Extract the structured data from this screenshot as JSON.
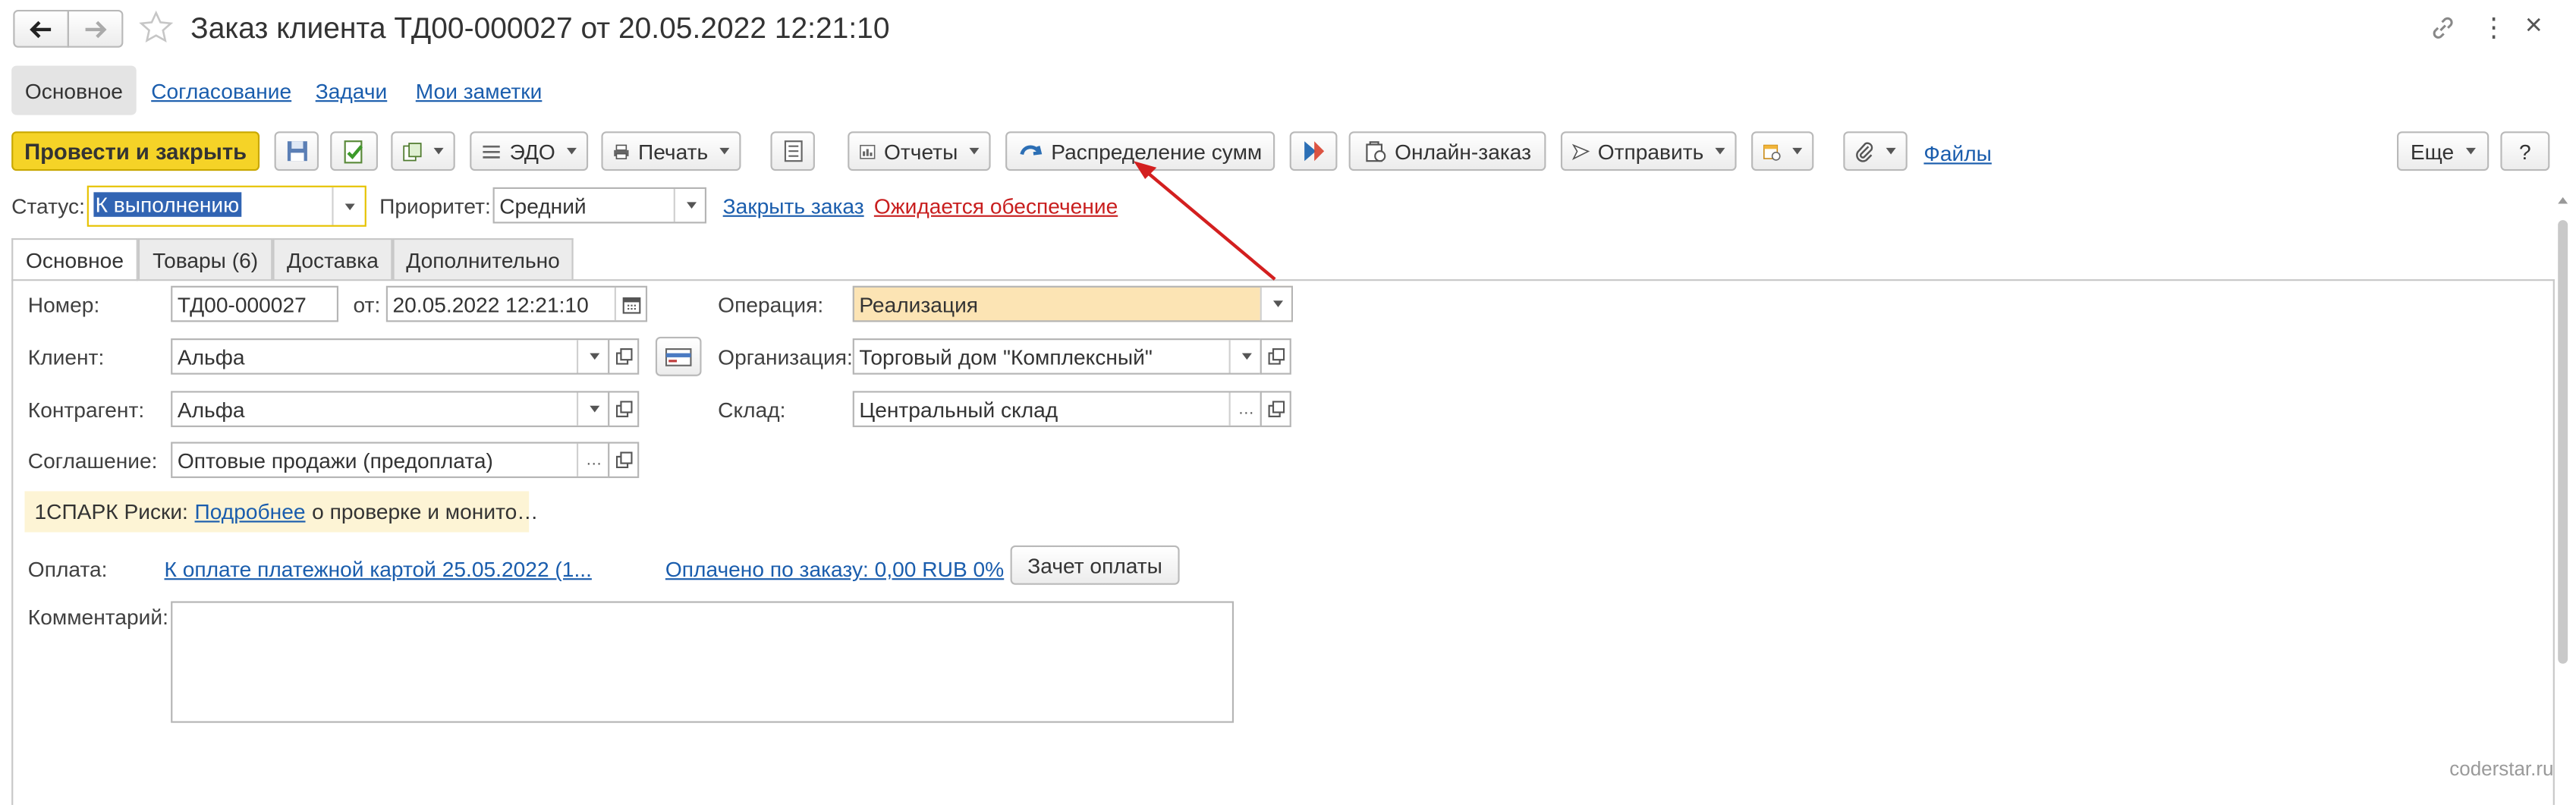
{
  "window": {
    "title": "Заказ клиента ТД00-000027 от 20.05.2022 12:21:10",
    "close_glyph": "×",
    "more_glyph": "⋮"
  },
  "nav": {
    "items": [
      "Основное",
      "Согласование",
      "Задачи",
      "Мои заметки"
    ]
  },
  "toolbar": {
    "post_close": "Провести и закрыть",
    "edo": "ЭДО",
    "print": "Печать",
    "reports": "Отчеты",
    "distribution": "Распределение сумм",
    "online_order": "Онлайн-заказ",
    "send": "Отправить",
    "files": "Файлы",
    "more": "Еще",
    "help": "?"
  },
  "status_row": {
    "status_label": "Статус:",
    "status_value": "К выполнению",
    "priority_label": "Приоритет:",
    "priority_value": "Средний",
    "close_order": "Закрыть заказ",
    "awaiting": "Ожидается обеспечение"
  },
  "tabs": [
    "Основное",
    "Товары (6)",
    "Доставка",
    "Дополнительно"
  ],
  "form": {
    "number_label": "Номер:",
    "number_value": "ТД00-000027",
    "from_label": "от:",
    "date_value": "20.05.2022 12:21:10",
    "client_label": "Клиент:",
    "client_value": "Альфа",
    "counterparty_label": "Контрагент:",
    "counterparty_value": "Альфа",
    "agreement_label": "Соглашение:",
    "agreement_value": "Оптовые продажи (предоплата)",
    "operation_label": "Операция:",
    "operation_value": "Реализация",
    "organization_label": "Организация:",
    "organization_value": "Торговый дом \"Комплексный\"",
    "warehouse_label": "Склад:",
    "warehouse_value": "Центральный склад",
    "spark_prefix": "1СПАРК Риски:",
    "spark_link": "Подробнее",
    "spark_suffix": "о проверке и монито…",
    "payment_label": "Оплата:",
    "payment_link": "К оплате платежной картой 25.05.2022 (1...",
    "paid_link": "Оплачено по заказу: 0,00 RUB 0%",
    "offset_button": "Зачет оплаты",
    "comment_label": "Комментарий:",
    "comment_value": ""
  },
  "watermark": "coderstar.ru",
  "colors": {
    "primary_button": "#f5d327",
    "link": "#1a5dad",
    "warning_link": "#c81e1e",
    "operation_field": "#fce4b4",
    "spark_banner": "#fdf4d5",
    "annotation_arrow": "#d31f1f"
  }
}
